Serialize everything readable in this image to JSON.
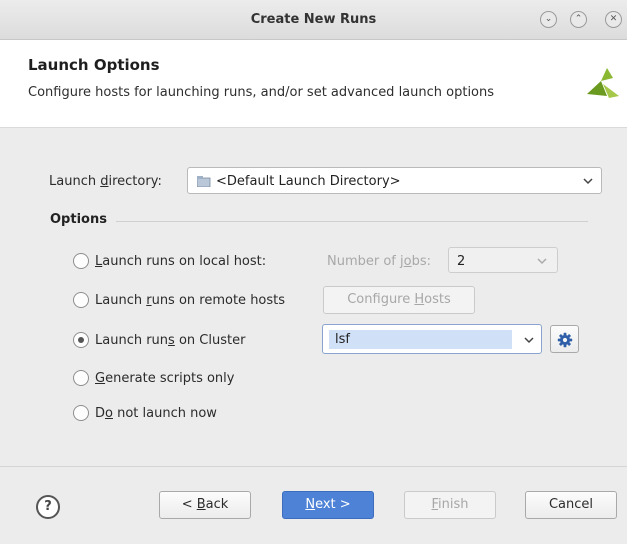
{
  "window": {
    "title": "Create New Runs",
    "minimize_glyph": "⌄",
    "maximize_glyph": "⌃",
    "close_glyph": "✕"
  },
  "header": {
    "title": "Launch Options",
    "subtitle": "Configure hosts for launching runs, and/or set advanced launch options",
    "logo_icon": "xilinx-logo-icon"
  },
  "launch_directory": {
    "label_before": "Launch ",
    "label_key": "d",
    "label_after": "irectory:",
    "value": "<Default Launch Directory>"
  },
  "options": {
    "title": "Options",
    "local": {
      "label_key": "L",
      "label_rest": "aunch runs on local host:",
      "jobs_label_before": "Number of j",
      "jobs_label_key": "o",
      "jobs_label_after": "bs:",
      "jobs_value": "2"
    },
    "remote": {
      "label_before": "Launch ",
      "label_key": "r",
      "label_after": "uns on remote hosts",
      "configure_before": "Configure ",
      "configure_key": "H",
      "configure_after": "osts"
    },
    "cluster": {
      "label_before": "Launch run",
      "label_key": "s",
      "label_after": " on Cluster",
      "value": "lsf",
      "selected": true
    },
    "scripts": {
      "label_key": "G",
      "label_rest": "enerate scripts only"
    },
    "none": {
      "label_before": "D",
      "label_key": "o",
      "label_after": " not launch now"
    }
  },
  "footer": {
    "help": "?",
    "back_before": "< ",
    "back_key": "B",
    "back_after": "ack",
    "next_key": "N",
    "next_after": "ext >",
    "finish_key": "F",
    "finish_after": "inish",
    "cancel": "Cancel"
  },
  "colors": {
    "primary_button": "#4d82d6",
    "selection": "#cfe0f7",
    "gear": "#2f5fa8"
  }
}
